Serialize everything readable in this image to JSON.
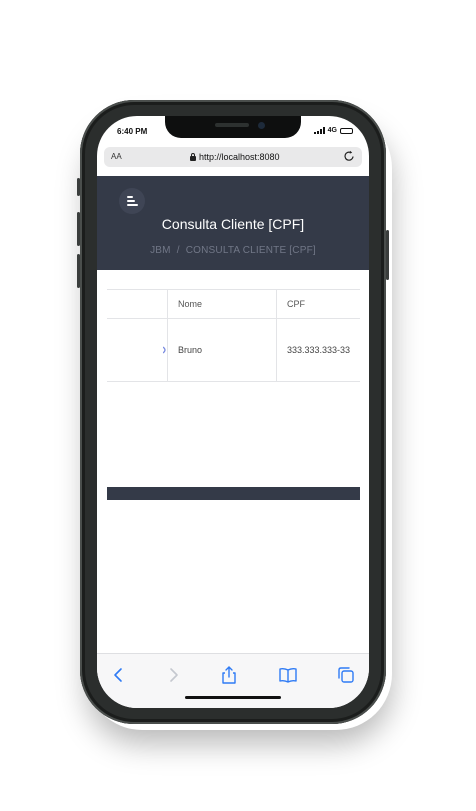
{
  "status_bar": {
    "time": "6:40 PM",
    "network": "4G"
  },
  "browser": {
    "text_size": "AA",
    "url": "http://localhost:8080"
  },
  "header": {
    "title": "Consulta Cliente [CPF]",
    "breadcrumb": {
      "home": "JBM",
      "separator": "/",
      "current": "CONSULTA CLIENTE [CPF]"
    }
  },
  "table": {
    "columns": [
      "",
      "Nome",
      "CPF"
    ],
    "rows": [
      {
        "first": "",
        "nome": "Bruno",
        "cpf": "333.333.333-33"
      }
    ]
  },
  "toolbar": {
    "icons": [
      "back-icon",
      "forward-icon",
      "share-icon",
      "bookmarks-icon",
      "tabs-icon"
    ],
    "accent": "#2f7bf5"
  },
  "colors": {
    "header_bg": "#343a48",
    "accent": "#2f7bf5"
  }
}
